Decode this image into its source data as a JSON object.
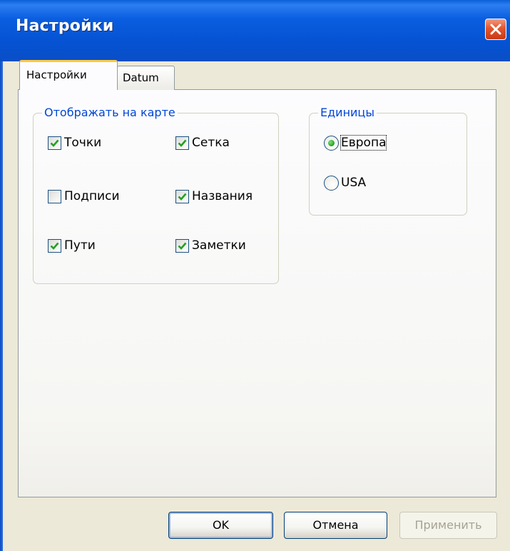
{
  "window": {
    "title": "Настройки",
    "close_icon": "close-icon"
  },
  "tabs": [
    {
      "label": "Настройки",
      "active": true
    },
    {
      "label": "Datum",
      "active": false
    }
  ],
  "display_group": {
    "legend": "Отображать на карте",
    "items": [
      {
        "label": "Точки",
        "checked": true
      },
      {
        "label": "Сетка",
        "checked": true
      },
      {
        "label": "Подписи",
        "checked": false
      },
      {
        "label": "Названия",
        "checked": true
      },
      {
        "label": "Пути",
        "checked": true
      },
      {
        "label": "Заметки",
        "checked": true
      }
    ]
  },
  "units_group": {
    "legend": "Единицы",
    "options": [
      {
        "label": "Европа",
        "selected": true
      },
      {
        "label": "USA",
        "selected": false
      }
    ]
  },
  "buttons": {
    "ok": "OK",
    "cancel": "Отмена",
    "apply": "Применить"
  },
  "colors": {
    "titlebar": "#0552d2",
    "legend_text": "#0046d5",
    "checkmark": "#21a121",
    "active_tab_accent": "#ffc83c"
  }
}
